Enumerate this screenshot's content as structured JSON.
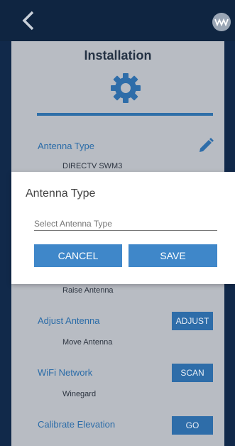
{
  "header": {
    "back_icon": "chevron-left-icon",
    "logo_icon": "brand-logo-icon"
  },
  "page": {
    "title": "Installation",
    "gear_icon": "gear-icon"
  },
  "settings": [
    {
      "label": "Antenna Type",
      "value": "DIRECTV SWM3",
      "action": "edit-pencil-icon"
    },
    {
      "label": "",
      "value": "Raise Antenna",
      "action": ""
    },
    {
      "label": "Adjust Antenna",
      "value": "Move Antenna",
      "action": "ADJUST"
    },
    {
      "label": "WiFi Network",
      "value": "Winegard",
      "action": "SCAN"
    },
    {
      "label": "Calibrate Elevation",
      "value": "",
      "action": "GO"
    }
  ],
  "dialog": {
    "title": "Antenna Type",
    "input_placeholder": "Select Antenna Type",
    "cancel_label": "CANCEL",
    "save_label": "SAVE"
  },
  "colors": {
    "accent": "#2e6da9",
    "dialog_button": "#3f87c9",
    "panel": "#b8bcc3",
    "frame": "#11294a"
  }
}
